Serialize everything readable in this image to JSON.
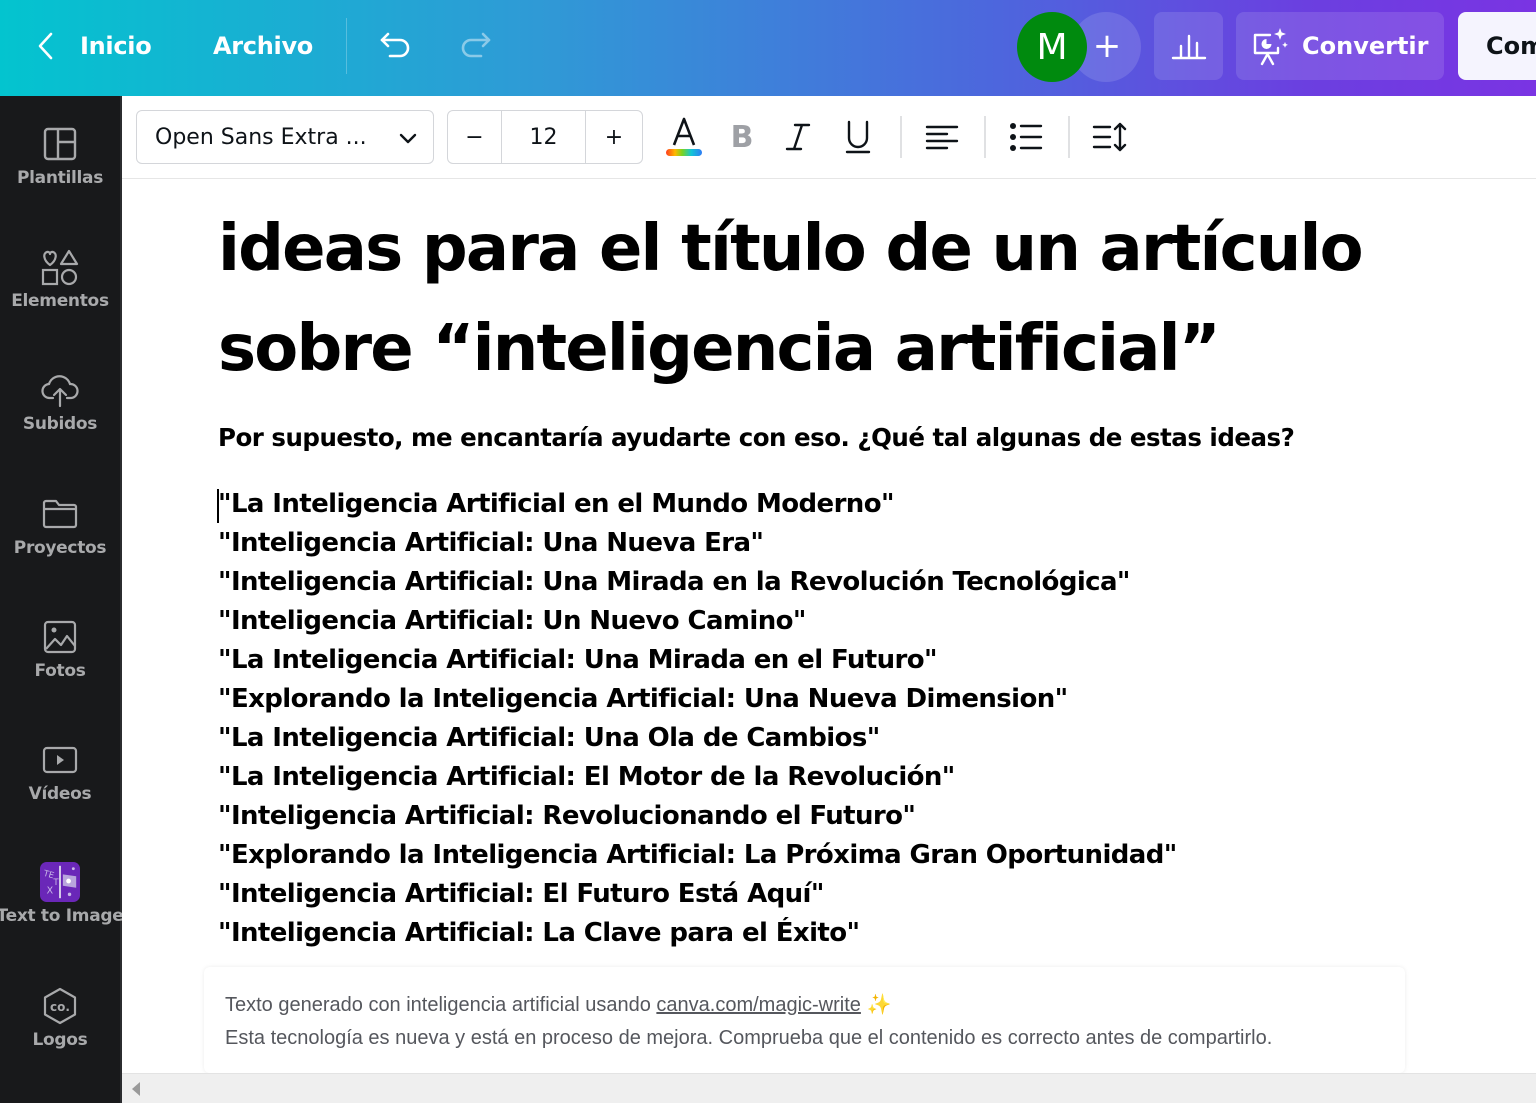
{
  "topbar": {
    "home_label": "Inicio",
    "file_label": "Archivo",
    "avatar_initial": "M",
    "add_collaborator_glyph": "+",
    "convert_label": "Convertir",
    "share_label": "Compartir",
    "colors": {
      "avatar_bg": "#008a0e",
      "gradient_start": "#03c4cf",
      "gradient_end": "#7a34e3"
    }
  },
  "sidebar": {
    "items": [
      {
        "label": "Plantillas",
        "icon": "layout-icon"
      },
      {
        "label": "Elementos",
        "icon": "shapes-icon"
      },
      {
        "label": "Subidos",
        "icon": "cloud-upload-icon"
      },
      {
        "label": "Proyectos",
        "icon": "folder-icon"
      },
      {
        "label": "Fotos",
        "icon": "image-icon"
      },
      {
        "label": "Vídeos",
        "icon": "video-icon"
      },
      {
        "label": "Text to Image",
        "icon": "text-to-image-app-icon"
      },
      {
        "label": "Logos",
        "icon": "logo-hexagon-icon"
      }
    ]
  },
  "format_toolbar": {
    "font_family_value": "Open Sans Extra ...",
    "font_size_minus": "−",
    "font_size_value": "12",
    "font_size_plus": "+",
    "text_color_glyph": "A",
    "bold_glyph": "B",
    "italic_glyph": "I",
    "underline_glyph": "U"
  },
  "document": {
    "title_lines": [
      "ideas para el título de un artículo",
      "sobre “inteligencia artificial”"
    ],
    "subtitle": "Por supuesto, me encantaría ayudarte con eso. ¿Qué tal algunas de estas ideas?",
    "ideas": [
      "\"La Inteligencia Artificial en el Mundo Moderno\"",
      "\"Inteligencia Artificial: Una Nueva Era\"",
      "\"Inteligencia Artificial: Una Mirada en la Revolución Tecnológica\"",
      "\"Inteligencia Artificial: Un Nuevo Camino\"",
      "\"La Inteligencia Artificial: Una Mirada en el Futuro\"",
      "\"Explorando la Inteligencia Artificial: Una Nueva Dimension\"",
      "\"La Inteligencia Artificial: Una Ola de Cambios\"",
      "\"La Inteligencia Artificial: El Motor de la Revolución\"",
      "\"Inteligencia Artificial: Revolucionando el Futuro\"",
      "\"Explorando la Inteligencia Artificial: La Próxima Gran Oportunidad\"",
      "\"Inteligencia Artificial: El Futuro Está Aquí\"",
      "\"Inteligencia Artificial: La Clave para el Éxito\""
    ]
  },
  "note": {
    "line1_prefix": "Texto generado con inteligencia artificial usando ",
    "link_text": "canva.com/magic-write",
    "sparkle": "✨",
    "line2": "Esta tecnología es nueva y está en proceso de mejora. Comprueba que el contenido es correcto antes de compartirlo."
  }
}
